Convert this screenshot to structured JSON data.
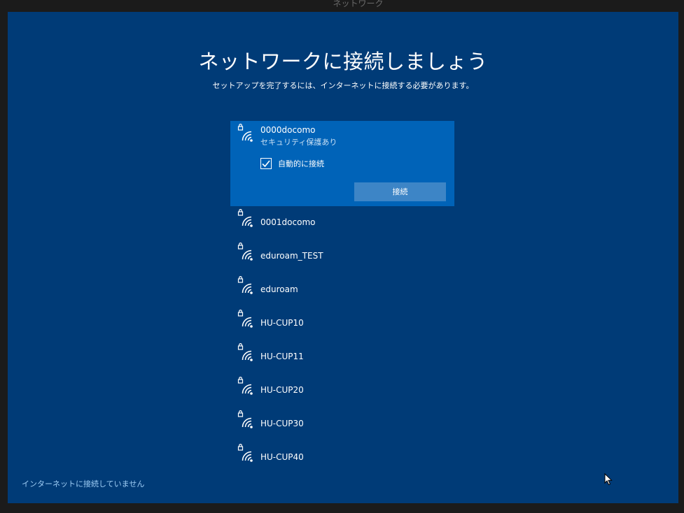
{
  "top_tab": {
    "label": "ネットワーク"
  },
  "header": {
    "title": "ネットワークに接続しましょう",
    "subtitle": "セットアップを完了するには、インターネットに接続する必要があります。"
  },
  "networks": [
    {
      "name": "0000docomo",
      "security": "セキュリティ保護あり",
      "secured": true,
      "selected": true
    },
    {
      "name": "0001docomo",
      "secured": true
    },
    {
      "name": "eduroam_TEST",
      "secured": true
    },
    {
      "name": "eduroam",
      "secured": true
    },
    {
      "name": "HU-CUP10",
      "secured": true
    },
    {
      "name": "HU-CUP11",
      "secured": true
    },
    {
      "name": "HU-CUP20",
      "secured": true
    },
    {
      "name": "HU-CUP30",
      "secured": true
    },
    {
      "name": "HU-CUP40",
      "secured": true
    }
  ],
  "selected_panel": {
    "auto_connect_label": "自動的に接続",
    "auto_connect_checked": true,
    "connect_label": "接続"
  },
  "footer": {
    "status": "インターネットに接続していません"
  },
  "colors": {
    "background": "#003b77",
    "selected": "#0063b8",
    "button": "#3d85c6",
    "status_text": "#9ecdf5"
  }
}
